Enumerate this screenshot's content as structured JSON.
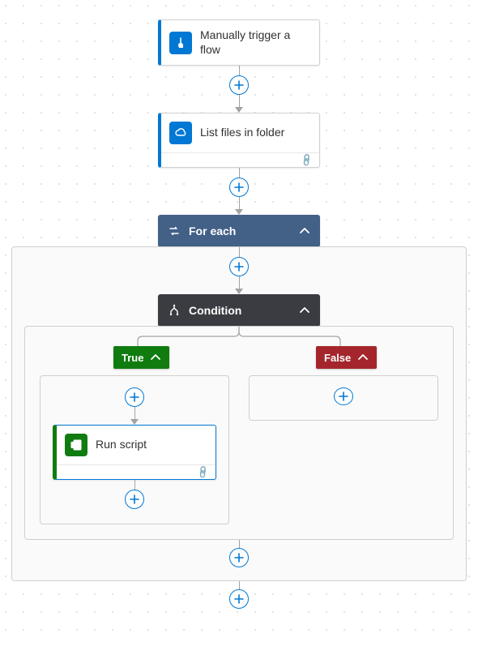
{
  "trigger": {
    "label": "Manually trigger a flow",
    "icon_color": "#0078d4"
  },
  "action_list_files": {
    "label": "List files in folder",
    "icon_color": "#0078d4"
  },
  "for_each": {
    "label": "For each",
    "bg": "#436087"
  },
  "condition": {
    "label": "Condition",
    "bg": "#3a3c42"
  },
  "branches": {
    "true_label": "True",
    "false_label": "False"
  },
  "run_script": {
    "label": "Run script",
    "icon_color": "#107c10"
  }
}
